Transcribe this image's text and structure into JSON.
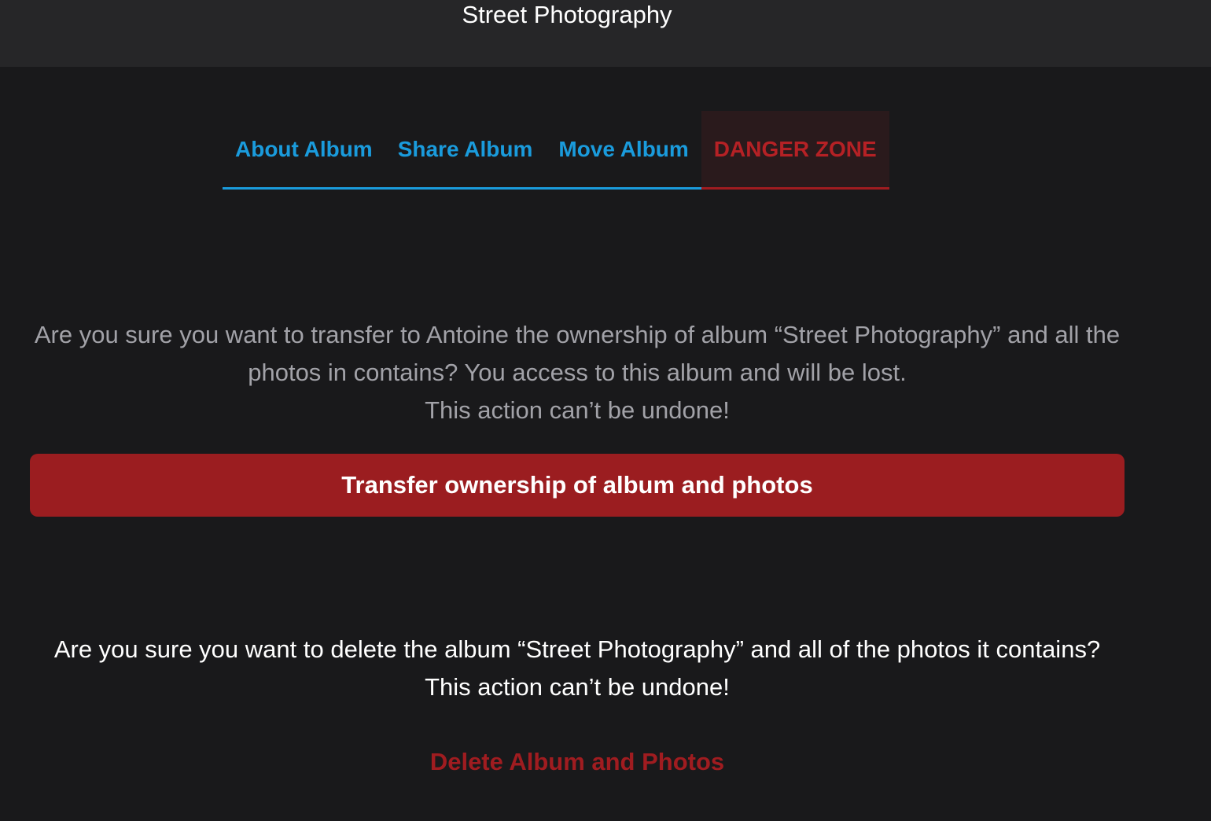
{
  "header": {
    "title": "Street Photography"
  },
  "tabs": [
    {
      "label": "About Album"
    },
    {
      "label": "Share Album"
    },
    {
      "label": "Move Album"
    },
    {
      "label": "DANGER ZONE"
    }
  ],
  "transfer": {
    "question": "Are you sure you want to transfer to Antoine the ownership of album “Street Photography” and all the photos in contains? You access to this album and will be lost.",
    "warning": "This action can’t be undone!",
    "button_label": "Transfer ownership of album and photos"
  },
  "delete": {
    "question": "Are you sure you want to delete the album “Street Photography” and all of the photos it contains?",
    "warning": "This action can’t be undone!",
    "button_label": "Delete Album and Photos"
  },
  "colors": {
    "background": "#19191b",
    "header_background": "#262628",
    "accent_blue": "#1a9bdc",
    "danger_red": "#9b1d20",
    "muted_text": "#a2a2a8"
  }
}
